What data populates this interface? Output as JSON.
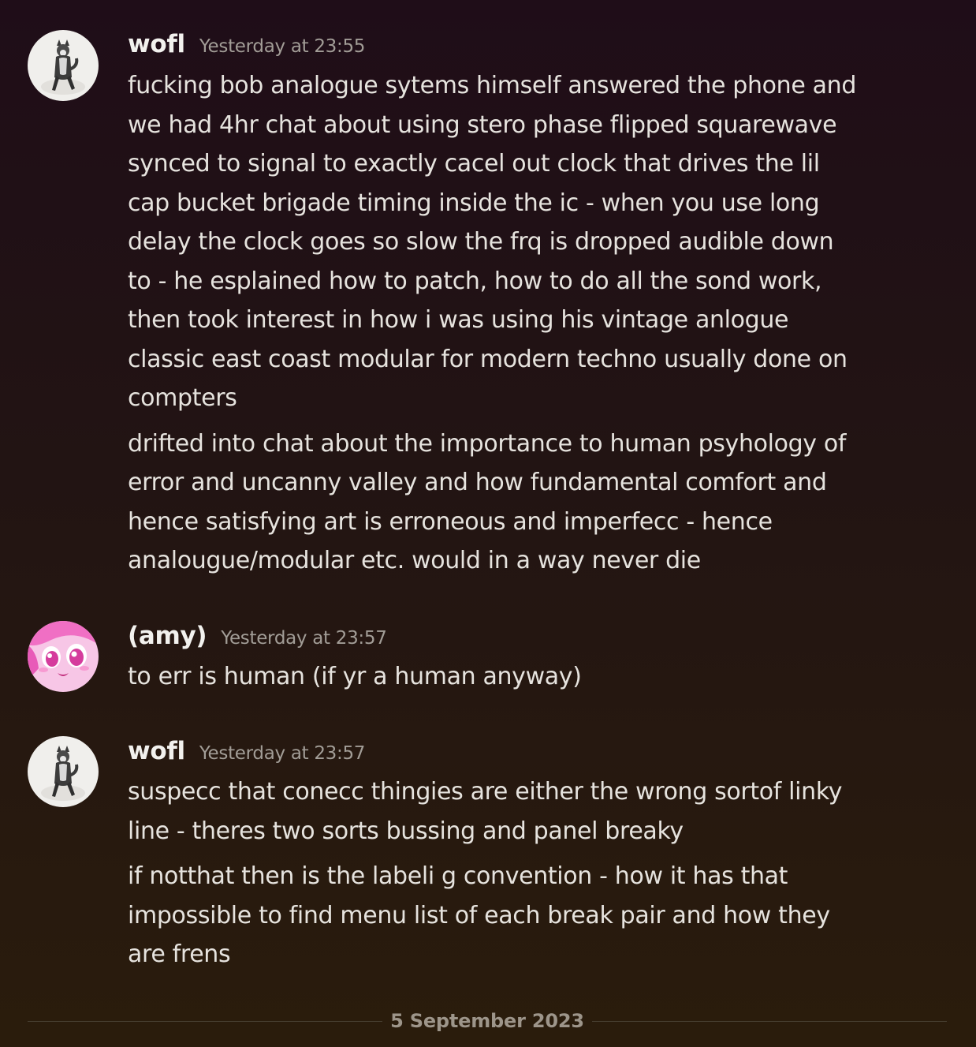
{
  "messages": [
    {
      "username": "wofl",
      "timestamp": "Yesterday at 23:55",
      "avatar_icon": "husky-dog-avatar",
      "paragraphs": [
        [
          "fucking bob analogue sytems himself answered the phone and",
          "we had 4hr chat about using stero phase flipped squarewave",
          "synced to signal to exactly cacel out clock that drives the lil",
          "cap bucket brigade timing inside the ic - when you use long",
          "delay the clock goes so slow the frq is dropped audible down",
          "to  - he esplained how to patch, how to do all the sond work,",
          "then took interest in how i  was using his vintage anlogue",
          "classic east coast modular for modern techno usually done on",
          "compters"
        ],
        [
          "drifted into chat about the importance to human psyhology of",
          "error and uncanny valley and how fundamental comfort and",
          "hence satisfying art is erroneous and imperfecc - hence",
          "analougue/modular etc. would in a way never die"
        ]
      ]
    },
    {
      "username": "(amy)",
      "timestamp": "Yesterday at 23:57",
      "avatar_icon": "pink-anime-avatar",
      "paragraphs": [
        [
          "to err is human (if yr a human anyway)"
        ]
      ]
    },
    {
      "username": "wofl",
      "timestamp": "Yesterday at 23:57",
      "avatar_icon": "husky-dog-avatar",
      "paragraphs": [
        [
          "suspecc  that conecc thingies are either the wrong sortof linky",
          "line - theres two sorts bussing and panel breaky"
        ],
        [
          "if notthat then is the labeli g convention - how it has that",
          "impossible to find menu list of each break pair and how they",
          "are frens"
        ]
      ]
    }
  ],
  "date_divider": "5 September 2023",
  "colors": {
    "username": "#f2f1ee",
    "timestamp": "#a29d97",
    "message_text": "#e6e3de",
    "divider_text": "#9d958a"
  }
}
